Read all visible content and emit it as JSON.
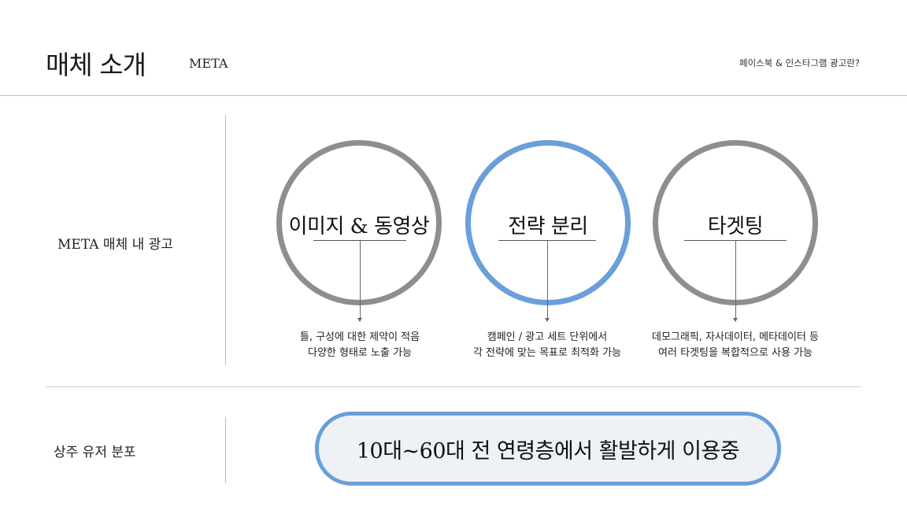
{
  "header": {
    "title": "매체 소개",
    "subtitle": "META",
    "top_right": "페이스북 & 인스타그램 광고란?"
  },
  "rows": [
    {
      "label": "META 매체 내 광고",
      "circles": [
        {
          "text": "이미지 & 동영상",
          "color": "#8e8e8e",
          "desc": [
            "틀, 구성에 대한 제약이 적음",
            "다양한 형태로 노출 가능"
          ]
        },
        {
          "text": "전략 분리",
          "color": "#6a9fd9",
          "desc": [
            "캠페인 / 광고 세트 단위에서",
            "각 전략에 맞는 목표로 최적화 가능"
          ]
        },
        {
          "text": "타겟팅",
          "color": "#8e8e8e",
          "desc": [
            "데모그래픽, 자사데이터, 메타데이터 등",
            "여러 타겟팅을 복합적으로 사용 가능"
          ]
        }
      ]
    },
    {
      "label": "상주 유저 분포",
      "pill": "10대~60대 전 연령층에서 활발하게 이용중"
    }
  ],
  "colors": {
    "accent_blue": "#6a9fd9",
    "circle_gray": "#8e8e8e",
    "pill_fill": "#eef2f7"
  }
}
